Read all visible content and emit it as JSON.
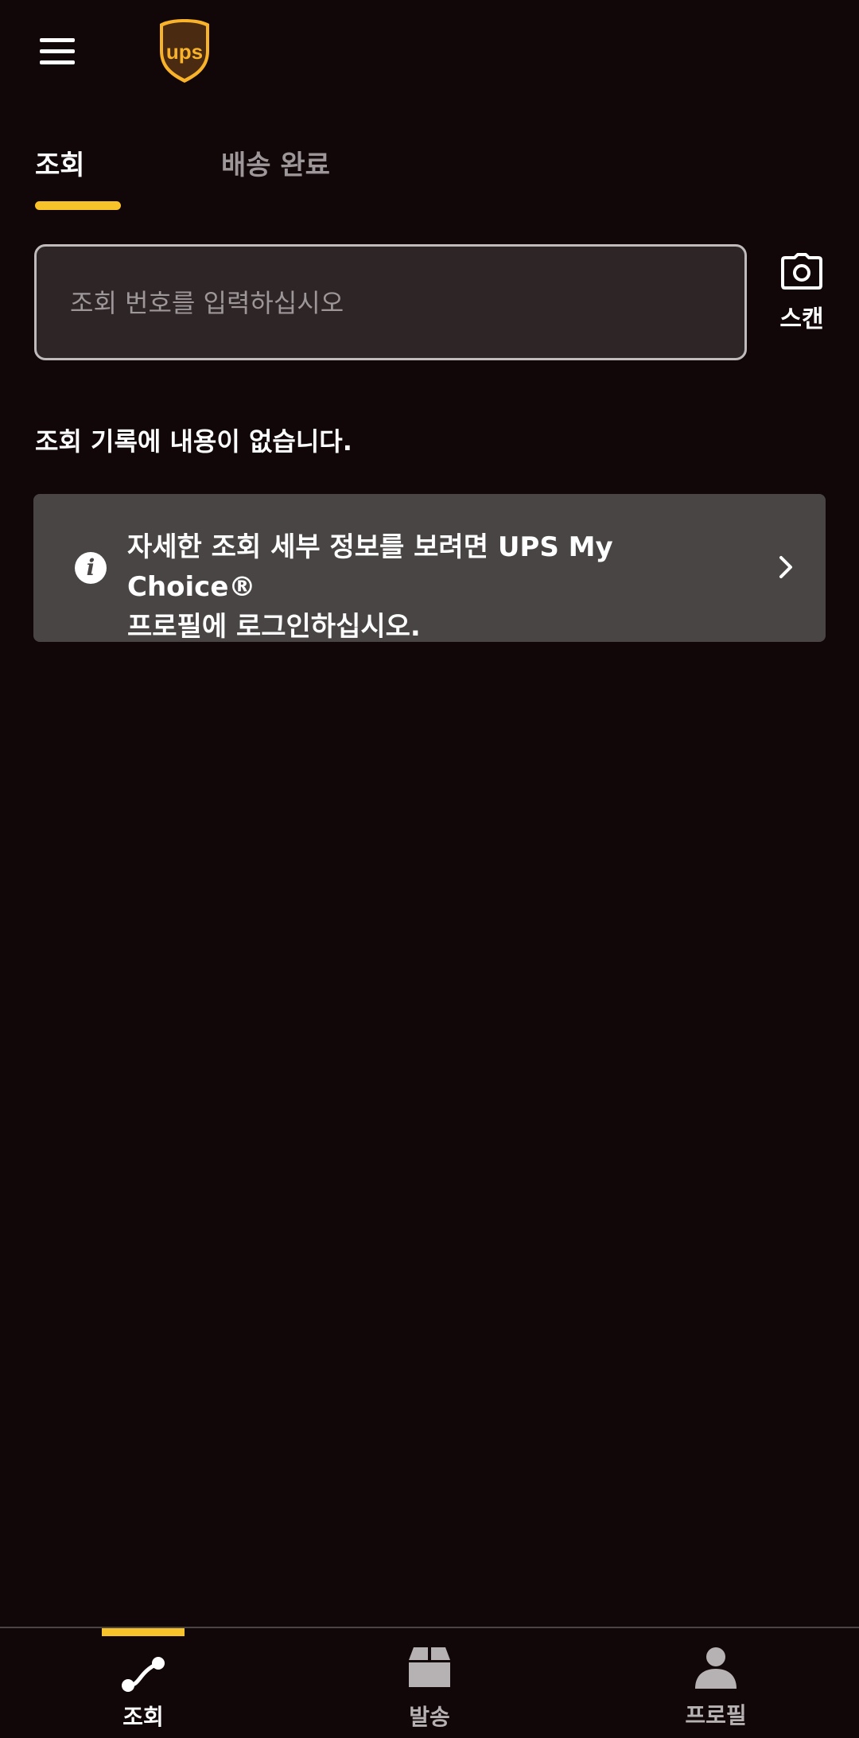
{
  "colors": {
    "background": "#110708",
    "accent": "#f8c22a",
    "card": "#4a4545",
    "muted_text": "#9d9799",
    "brand_brown": "#4b2a12"
  },
  "header": {
    "logo_text": "ups"
  },
  "tabs": [
    {
      "label": "조회",
      "active": true
    },
    {
      "label": "배송 완료",
      "active": false
    }
  ],
  "search": {
    "placeholder": "조회 번호를 입력하십시오",
    "value": ""
  },
  "scan": {
    "label": "스캔",
    "icon": "camera-icon"
  },
  "empty_message": "조회 기록에 내용이 없습니다.",
  "info_card": {
    "line1": "자세한 조회 세부 정보를 보려면 UPS My Choice®",
    "line2": "프로필에 로그인하십시오.",
    "icon": "info-icon"
  },
  "bottom_nav": [
    {
      "label": "조회",
      "icon": "route-icon",
      "active": true
    },
    {
      "label": "발송",
      "icon": "package-icon",
      "active": false
    },
    {
      "label": "프로필",
      "icon": "person-icon",
      "active": false
    }
  ]
}
